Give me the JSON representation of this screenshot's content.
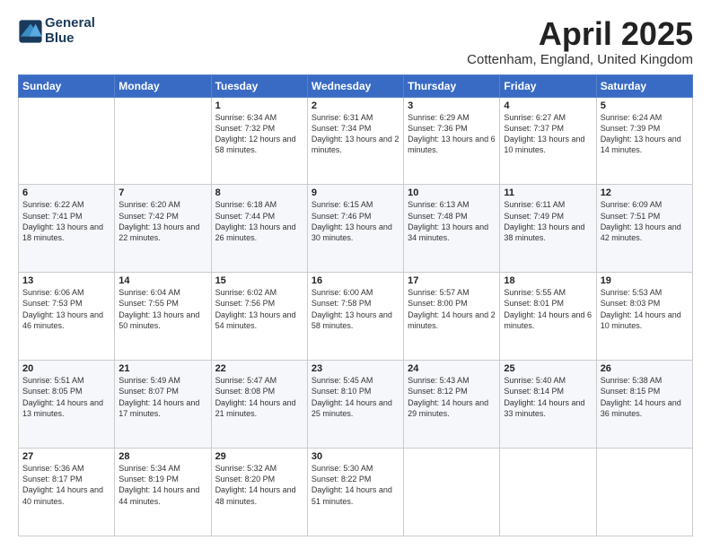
{
  "logo": {
    "line1": "General",
    "line2": "Blue"
  },
  "title": "April 2025",
  "location": "Cottenham, England, United Kingdom",
  "headers": [
    "Sunday",
    "Monday",
    "Tuesday",
    "Wednesday",
    "Thursday",
    "Friday",
    "Saturday"
  ],
  "weeks": [
    [
      {
        "day": "",
        "info": ""
      },
      {
        "day": "",
        "info": ""
      },
      {
        "day": "1",
        "info": "Sunrise: 6:34 AM\nSunset: 7:32 PM\nDaylight: 12 hours\nand 58 minutes."
      },
      {
        "day": "2",
        "info": "Sunrise: 6:31 AM\nSunset: 7:34 PM\nDaylight: 13 hours\nand 2 minutes."
      },
      {
        "day": "3",
        "info": "Sunrise: 6:29 AM\nSunset: 7:36 PM\nDaylight: 13 hours\nand 6 minutes."
      },
      {
        "day": "4",
        "info": "Sunrise: 6:27 AM\nSunset: 7:37 PM\nDaylight: 13 hours\nand 10 minutes."
      },
      {
        "day": "5",
        "info": "Sunrise: 6:24 AM\nSunset: 7:39 PM\nDaylight: 13 hours\nand 14 minutes."
      }
    ],
    [
      {
        "day": "6",
        "info": "Sunrise: 6:22 AM\nSunset: 7:41 PM\nDaylight: 13 hours\nand 18 minutes."
      },
      {
        "day": "7",
        "info": "Sunrise: 6:20 AM\nSunset: 7:42 PM\nDaylight: 13 hours\nand 22 minutes."
      },
      {
        "day": "8",
        "info": "Sunrise: 6:18 AM\nSunset: 7:44 PM\nDaylight: 13 hours\nand 26 minutes."
      },
      {
        "day": "9",
        "info": "Sunrise: 6:15 AM\nSunset: 7:46 PM\nDaylight: 13 hours\nand 30 minutes."
      },
      {
        "day": "10",
        "info": "Sunrise: 6:13 AM\nSunset: 7:48 PM\nDaylight: 13 hours\nand 34 minutes."
      },
      {
        "day": "11",
        "info": "Sunrise: 6:11 AM\nSunset: 7:49 PM\nDaylight: 13 hours\nand 38 minutes."
      },
      {
        "day": "12",
        "info": "Sunrise: 6:09 AM\nSunset: 7:51 PM\nDaylight: 13 hours\nand 42 minutes."
      }
    ],
    [
      {
        "day": "13",
        "info": "Sunrise: 6:06 AM\nSunset: 7:53 PM\nDaylight: 13 hours\nand 46 minutes."
      },
      {
        "day": "14",
        "info": "Sunrise: 6:04 AM\nSunset: 7:55 PM\nDaylight: 13 hours\nand 50 minutes."
      },
      {
        "day": "15",
        "info": "Sunrise: 6:02 AM\nSunset: 7:56 PM\nDaylight: 13 hours\nand 54 minutes."
      },
      {
        "day": "16",
        "info": "Sunrise: 6:00 AM\nSunset: 7:58 PM\nDaylight: 13 hours\nand 58 minutes."
      },
      {
        "day": "17",
        "info": "Sunrise: 5:57 AM\nSunset: 8:00 PM\nDaylight: 14 hours\nand 2 minutes."
      },
      {
        "day": "18",
        "info": "Sunrise: 5:55 AM\nSunset: 8:01 PM\nDaylight: 14 hours\nand 6 minutes."
      },
      {
        "day": "19",
        "info": "Sunrise: 5:53 AM\nSunset: 8:03 PM\nDaylight: 14 hours\nand 10 minutes."
      }
    ],
    [
      {
        "day": "20",
        "info": "Sunrise: 5:51 AM\nSunset: 8:05 PM\nDaylight: 14 hours\nand 13 minutes."
      },
      {
        "day": "21",
        "info": "Sunrise: 5:49 AM\nSunset: 8:07 PM\nDaylight: 14 hours\nand 17 minutes."
      },
      {
        "day": "22",
        "info": "Sunrise: 5:47 AM\nSunset: 8:08 PM\nDaylight: 14 hours\nand 21 minutes."
      },
      {
        "day": "23",
        "info": "Sunrise: 5:45 AM\nSunset: 8:10 PM\nDaylight: 14 hours\nand 25 minutes."
      },
      {
        "day": "24",
        "info": "Sunrise: 5:43 AM\nSunset: 8:12 PM\nDaylight: 14 hours\nand 29 minutes."
      },
      {
        "day": "25",
        "info": "Sunrise: 5:40 AM\nSunset: 8:14 PM\nDaylight: 14 hours\nand 33 minutes."
      },
      {
        "day": "26",
        "info": "Sunrise: 5:38 AM\nSunset: 8:15 PM\nDaylight: 14 hours\nand 36 minutes."
      }
    ],
    [
      {
        "day": "27",
        "info": "Sunrise: 5:36 AM\nSunset: 8:17 PM\nDaylight: 14 hours\nand 40 minutes."
      },
      {
        "day": "28",
        "info": "Sunrise: 5:34 AM\nSunset: 8:19 PM\nDaylight: 14 hours\nand 44 minutes."
      },
      {
        "day": "29",
        "info": "Sunrise: 5:32 AM\nSunset: 8:20 PM\nDaylight: 14 hours\nand 48 minutes."
      },
      {
        "day": "30",
        "info": "Sunrise: 5:30 AM\nSunset: 8:22 PM\nDaylight: 14 hours\nand 51 minutes."
      },
      {
        "day": "",
        "info": ""
      },
      {
        "day": "",
        "info": ""
      },
      {
        "day": "",
        "info": ""
      }
    ]
  ]
}
